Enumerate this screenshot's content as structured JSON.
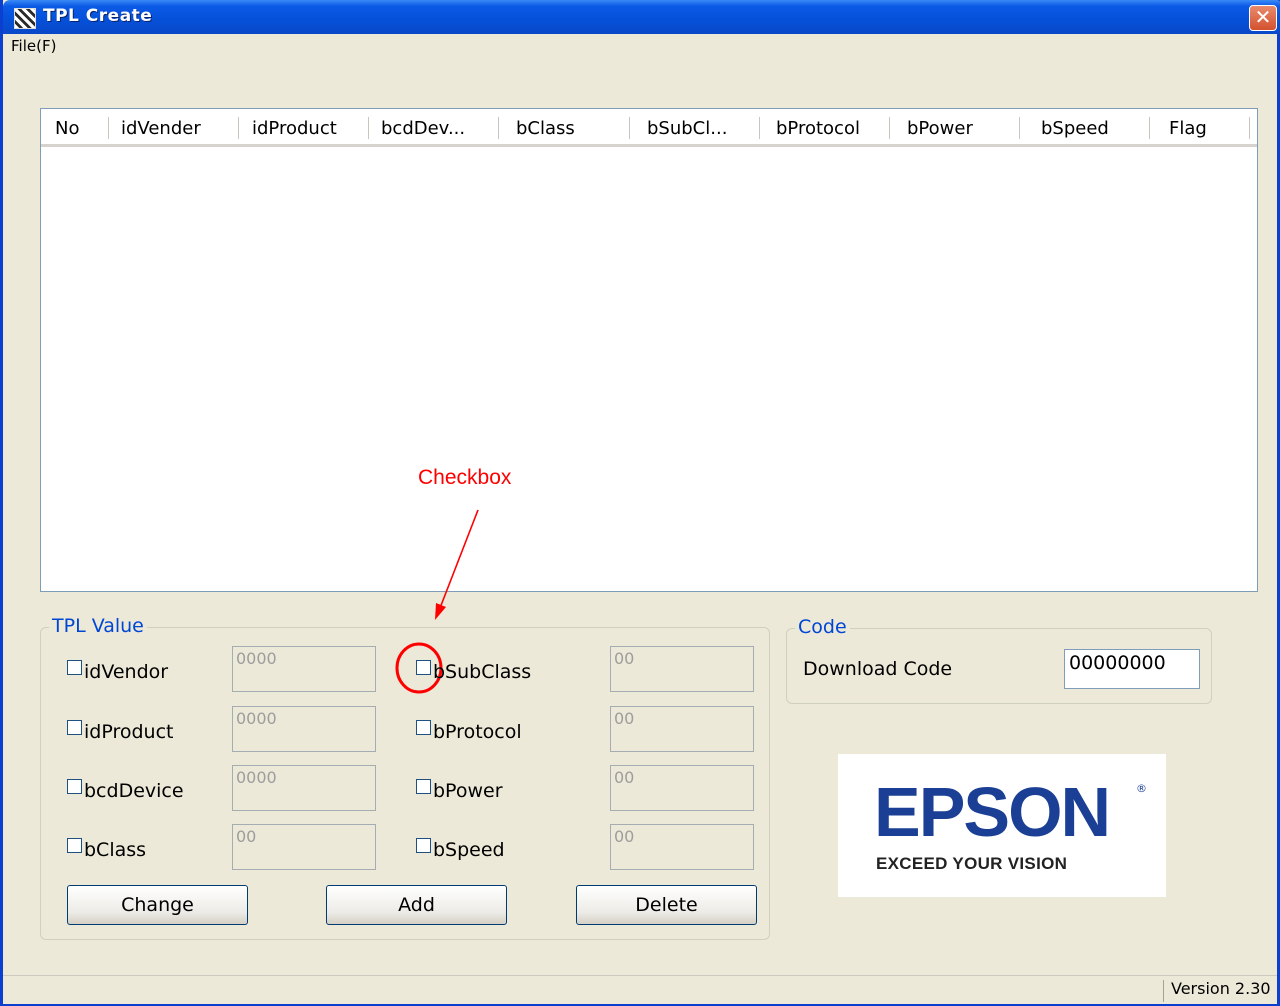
{
  "window": {
    "title": "TPL Create"
  },
  "menu": {
    "file": "File(F)"
  },
  "list": {
    "columns": [
      "No",
      "idVender",
      "idProduct",
      "bcdDev...",
      "bClass",
      "bSubCl...",
      "bProtocol",
      "bPower",
      "bSpeed",
      "Flag"
    ]
  },
  "annotation": {
    "label": "Checkbox",
    "color": "#ff0000"
  },
  "tpl_value": {
    "title": "TPL Value",
    "fields": [
      {
        "label": "idVendor",
        "value": "0000"
      },
      {
        "label": "idProduct",
        "value": "0000"
      },
      {
        "label": "bcdDevice",
        "value": "0000"
      },
      {
        "label": "bClass",
        "value": "00"
      },
      {
        "label": "bSubClass",
        "value": "00"
      },
      {
        "label": "bProtocol",
        "value": "00"
      },
      {
        "label": "bPower",
        "value": "00"
      },
      {
        "label": "bSpeed",
        "value": "00"
      }
    ],
    "buttons": {
      "change": "Change",
      "add": "Add",
      "delete": "Delete"
    }
  },
  "code": {
    "title": "Code",
    "download_label": "Download Code",
    "download_value": "00000000"
  },
  "logo": {
    "word": "EPSON",
    "tagline": "EXCEED YOUR VISION",
    "brand_color": "#1a3f95"
  },
  "status": {
    "version": "Version 2.30"
  },
  "colors": {
    "title_bar": "#0550d8",
    "group_title": "#0046d5",
    "close_button": "#d3512f"
  }
}
